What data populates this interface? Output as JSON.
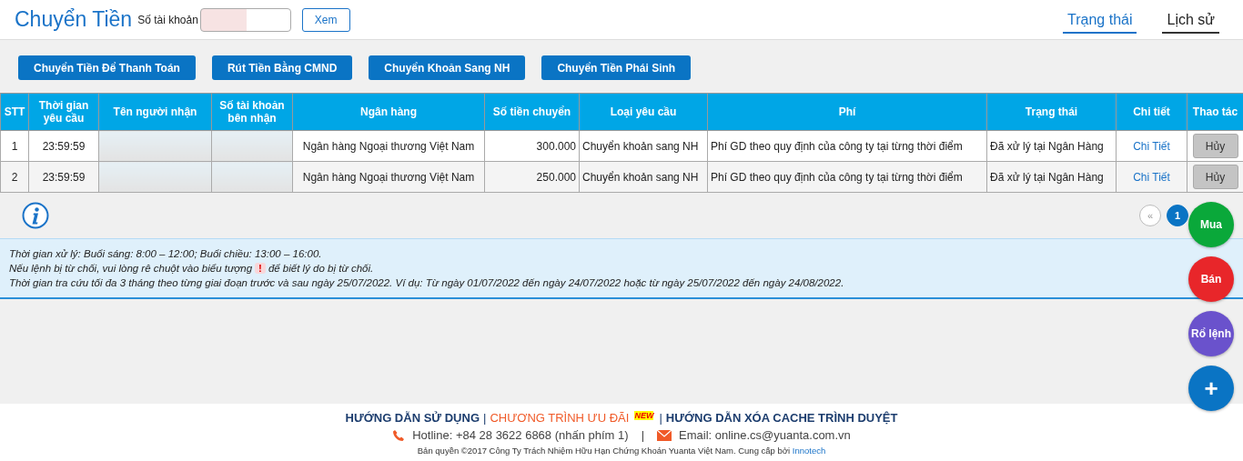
{
  "header": {
    "title": "Chuyển Tiền",
    "account_label": "Số tài khoản",
    "view_button": "Xem",
    "tabs": [
      {
        "label": "Trạng thái",
        "selected": true
      },
      {
        "label": "Lịch sử",
        "selected": false
      }
    ]
  },
  "actions": [
    "Chuyển Tiền Để Thanh Toán",
    "Rút Tiền Bằng CMND",
    "Chuyển Khoản Sang NH",
    "Chuyển Tiền Phái Sinh"
  ],
  "table": {
    "columns": [
      "STT",
      "Thời gian yêu cầu",
      "Tên người nhận",
      "Số tài khoản bên nhận",
      "Ngân hàng",
      "Số tiền chuyển",
      "Loại yêu cầu",
      "Phí",
      "Trạng thái",
      "Chi tiết",
      "Thao tác"
    ],
    "rows": [
      {
        "stt": "1",
        "time": "23:59:59",
        "bank": "Ngân hàng Ngoại thương Việt Nam",
        "amount": "300.000",
        "type": "Chuyển khoản sang NH",
        "fee": "Phí GD theo quy định của công ty tại từng thời điểm",
        "status": "Đã xử lý tại Ngân Hàng",
        "detail": "Chi Tiết",
        "action": "Hủy"
      },
      {
        "stt": "2",
        "time": "23:59:59",
        "bank": "Ngân hàng Ngoại thương Việt Nam",
        "amount": "250.000",
        "type": "Chuyển khoản sang NH",
        "fee": "Phí GD theo quy định của công ty tại từng thời điểm",
        "status": "Đã xử lý tại Ngân Hàng",
        "detail": "Chi Tiết",
        "action": "Hủy"
      }
    ]
  },
  "pagination": {
    "prev": "«",
    "pages": [
      {
        "label": "1",
        "selected": true
      }
    ]
  },
  "notes": [
    {
      "text": "Thời gian xử lý: Buổi sáng: 8:00 – 12:00; Buổi chiều: 13:00 – 16:00."
    },
    {
      "text": "Nếu lệnh bị từ chối, vui lòng rê chuột vào biểu tượng",
      "icon": "!",
      "after": "để biết lý do bị từ chối."
    },
    {
      "text": "Thời gian tra cứu tối đa 3 tháng theo từng giai đoạn trước và sau ngày 25/07/2022. Ví dụ: Từ ngày 01/07/2022 đến ngày 24/07/2022 hoặc từ ngày 25/07/2022 đến ngày 24/08/2022."
    }
  ],
  "floating_buttons": [
    {
      "label": "Mua",
      "color": "#0aa83a"
    },
    {
      "label": "Bán",
      "color": "#e8262a"
    },
    {
      "label": "Rổ lệnh",
      "color": "#6a52cc"
    },
    {
      "label": "+",
      "color": "#0a74c4"
    }
  ],
  "footer": {
    "links": [
      {
        "label": "HƯỚNG DẪN SỬ DỤNG",
        "highlight": false
      },
      {
        "label": "CHƯƠNG TRÌNH ƯU ĐÃI",
        "highlight": true,
        "badge": "NEW"
      },
      {
        "label": "HƯỚNG DẪN XÓA CACHE TRÌNH DUYỆT",
        "highlight": false
      }
    ],
    "separator": "|",
    "hotline": "Hotline: +84 28 3622 6868 (nhấn phím 1)",
    "contact_separator": "|",
    "email": "Email: online.cs@yuanta.com.vn",
    "copyright": "Bản quyền ©2017 Công Ty Trách Nhiệm Hữu Hạn Chứng Khoán Yuanta Việt Nam. Cung cấp bởi",
    "provider": "Innotech"
  }
}
